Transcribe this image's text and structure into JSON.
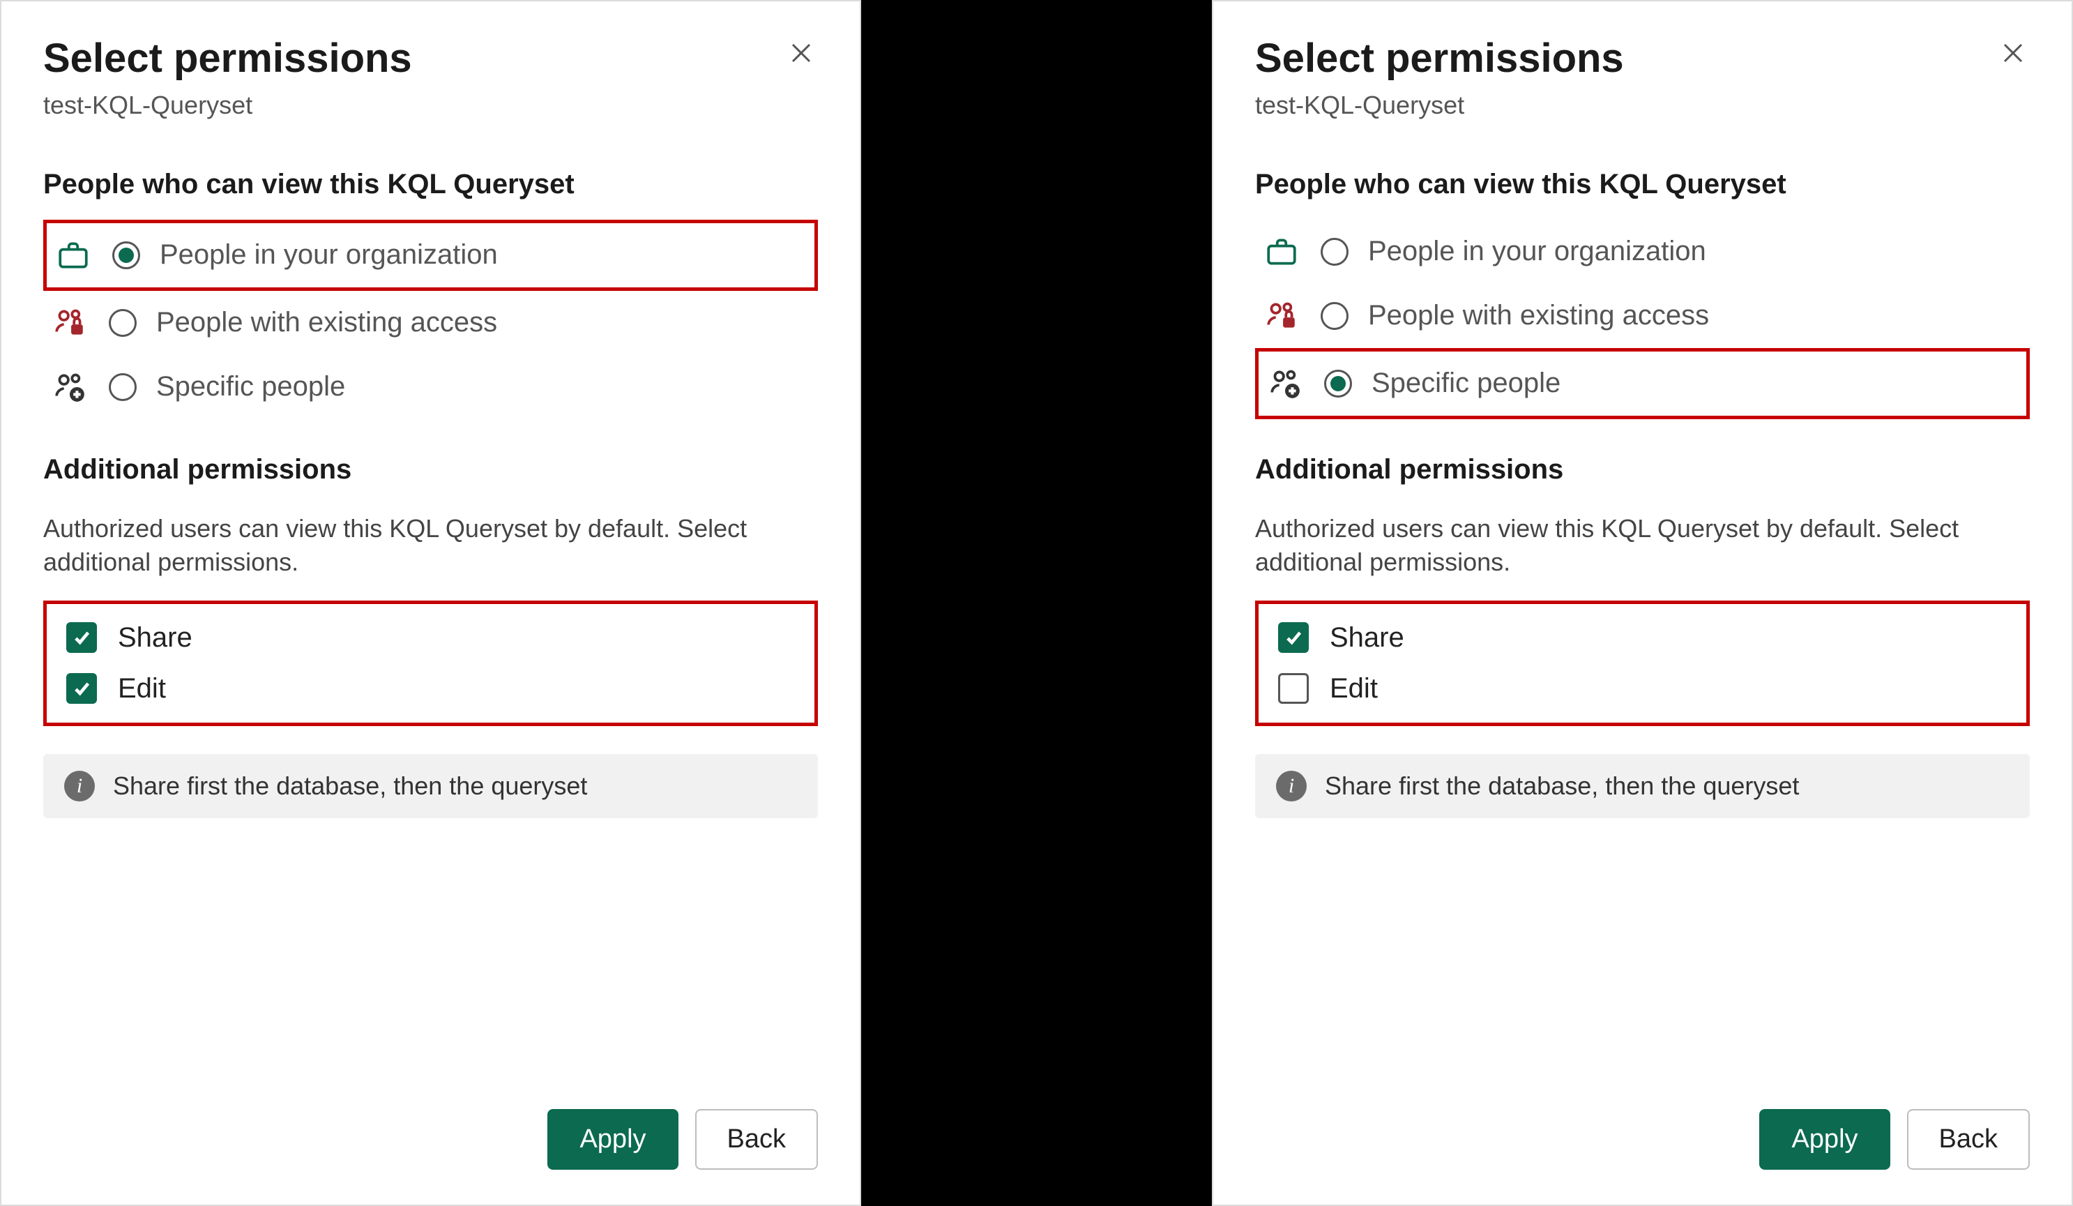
{
  "left": {
    "title": "Select permissions",
    "subtitle": "test-KQL-Queryset",
    "peopleHeading": "People who can view this KQL Queryset",
    "opts": {
      "org": "People in your organization",
      "existing": "People with existing access",
      "specific": "Specific people"
    },
    "additionalHeading": "Additional permissions",
    "additionalDesc": "Authorized users can view this KQL Queryset by default. Select additional permissions.",
    "checks": {
      "share": "Share",
      "edit": "Edit"
    },
    "info": "Share first the database, then the queryset",
    "buttons": {
      "apply": "Apply",
      "back": "Back"
    }
  },
  "right": {
    "title": "Select permissions",
    "subtitle": "test-KQL-Queryset",
    "peopleHeading": "People who can view this KQL Queryset",
    "opts": {
      "org": "People in your organization",
      "existing": "People with existing access",
      "specific": "Specific people"
    },
    "additionalHeading": "Additional permissions",
    "additionalDesc": "Authorized users can view this KQL Queryset by default. Select additional permissions.",
    "checks": {
      "share": "Share",
      "edit": "Edit"
    },
    "info": "Share first the database, then the queryset",
    "buttons": {
      "apply": "Apply",
      "back": "Back"
    }
  }
}
